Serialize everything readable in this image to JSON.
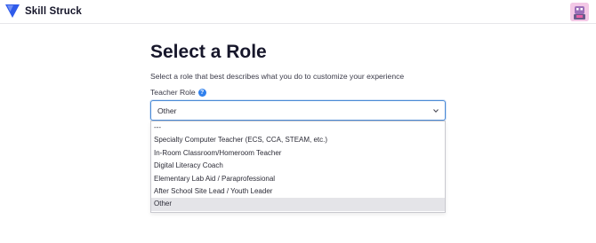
{
  "header": {
    "brand_name": "Skill Struck",
    "logo_icon": "skill-struck-logo-icon",
    "brand_color": "#2f5bea"
  },
  "page": {
    "title": "Select a Role",
    "subtitle": "Select a role that best describes what you do to customize your experience"
  },
  "field": {
    "label": "Teacher Role",
    "help_icon": "question-circle-icon",
    "selected_value": "Other",
    "options": [
      "---",
      "Specialty Computer Teacher (ECS, CCA, STEAM, etc.)",
      "In-Room Classroom/Homeroom Teacher",
      "Digital Literacy Coach",
      "Elementary Lab Aid / Paraprofessional",
      "After School Site Lead / Youth Leader",
      "Other"
    ],
    "selected_index": 6,
    "focus_color": "#4a8ad6"
  }
}
